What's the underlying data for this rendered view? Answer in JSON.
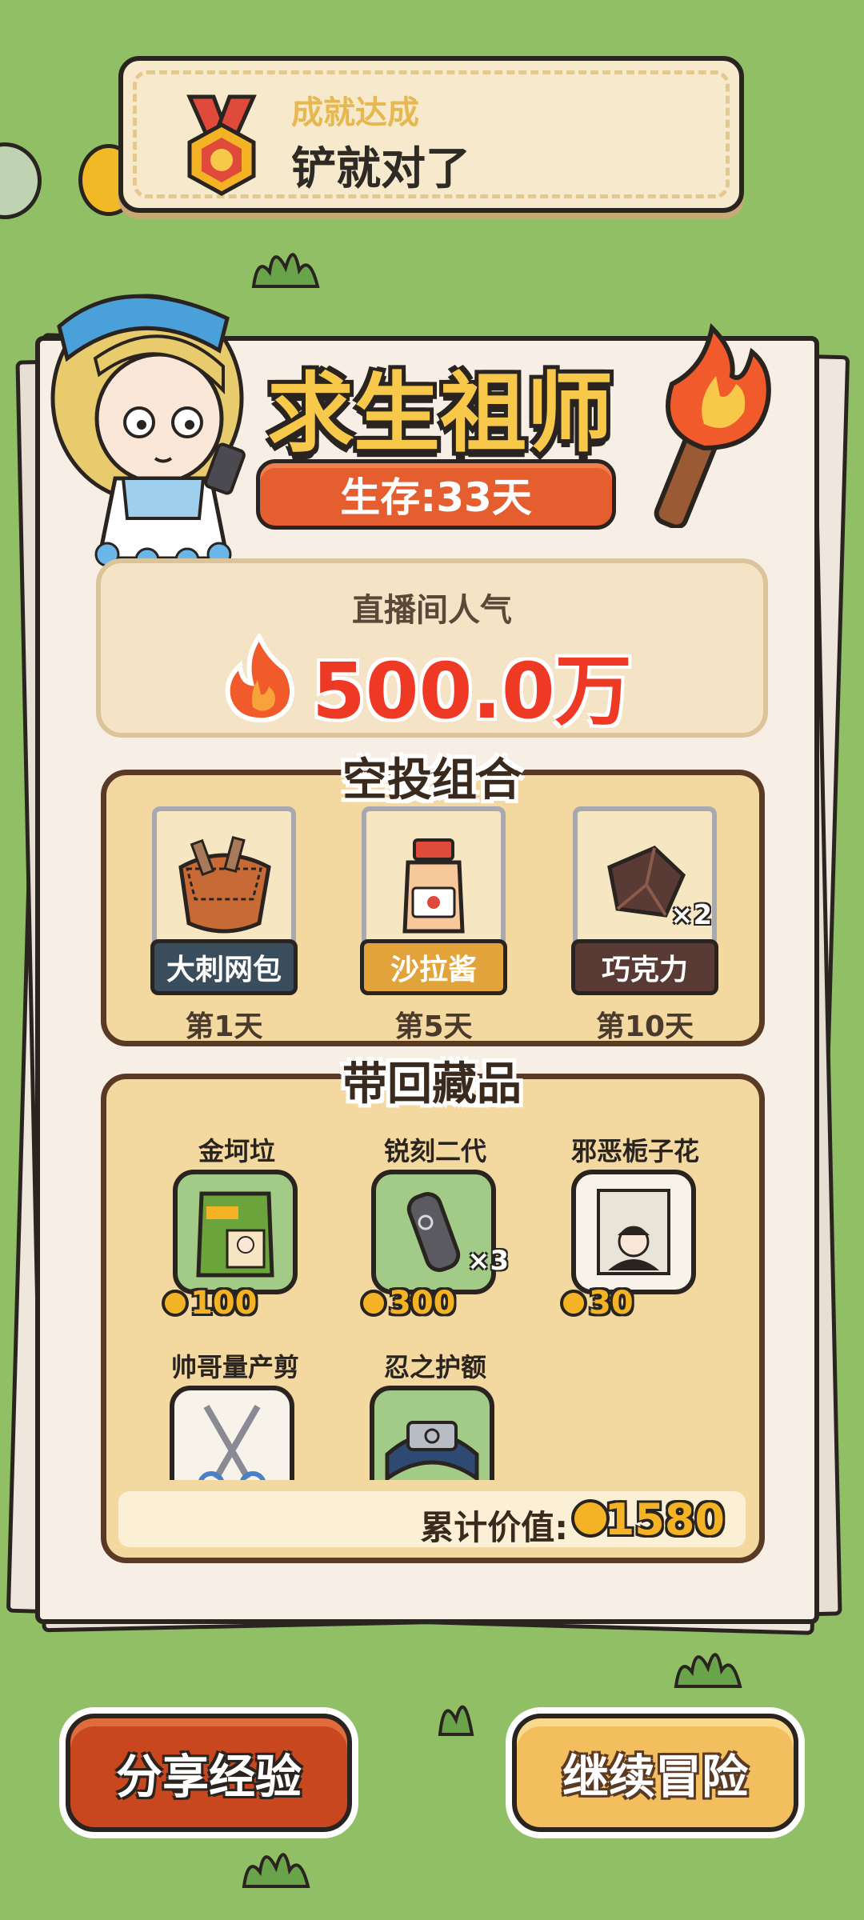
{
  "achievement": {
    "kicker": "成就达成",
    "title": "铲就对了",
    "medal_icon": "medal-icon"
  },
  "header": {
    "title": "求生祖师",
    "survival": "生存:33天"
  },
  "popularity": {
    "label": "直播间人气",
    "value": "500.0万",
    "icon": "fire-icon"
  },
  "airdrop": {
    "title": "空投组合",
    "items": [
      {
        "name": "大刺网包",
        "day": "第1天",
        "label_color": "#3a4d5c",
        "icon": "net-bag-icon",
        "qty": ""
      },
      {
        "name": "沙拉酱",
        "day": "第5天",
        "label_color": "#e2a43a",
        "icon": "sauce-bottle-icon",
        "qty": ""
      },
      {
        "name": "巧克力",
        "day": "第10天",
        "label_color": "#5a3a34",
        "icon": "chocolate-icon",
        "qty": "×2"
      }
    ]
  },
  "collection": {
    "title": "带回藏品",
    "items": [
      {
        "name": "金坷垃",
        "price": "100",
        "icon": "fertilizer-bag-icon",
        "qty": ""
      },
      {
        "name": "锐刻二代",
        "price": "300",
        "icon": "vape-icon",
        "qty": "×3"
      },
      {
        "name": "邪恶栀子花",
        "price": "30",
        "icon": "book-icon",
        "qty": ""
      },
      {
        "name": "帅哥量产剪",
        "price": "",
        "icon": "scissors-icon",
        "qty": ""
      },
      {
        "name": "忍之护额",
        "price": "",
        "icon": "headband-icon",
        "qty": ""
      }
    ],
    "total_label": "累计价值:",
    "total_value": "1580"
  },
  "buttons": {
    "share": "分享经验",
    "continue": "继续冒险"
  },
  "colors": {
    "background": "#90bf66",
    "accent_red": "#ee3a25",
    "coin_gold": "#f4b325"
  }
}
